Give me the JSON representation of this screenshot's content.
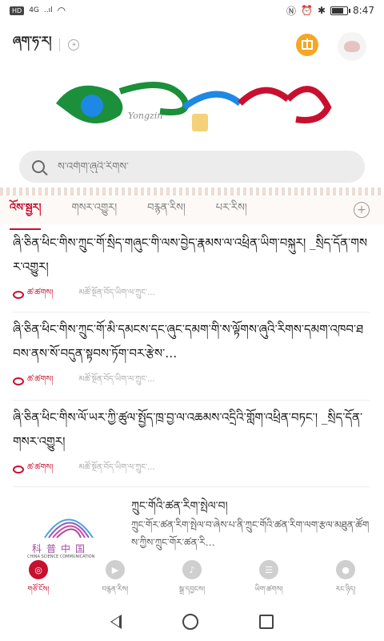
{
  "status_bar": {
    "left_badge": "HD",
    "network": "4G",
    "signal": "..ıl",
    "time": "8:47",
    "battery_level": 0.8
  },
  "header": {
    "city": "ཞག་ཧ་ར།",
    "weather_icon": "weather-icon",
    "gift_icon": "gift-icon",
    "avatar_icon": "avatar-icon"
  },
  "logo": {
    "text": "Yongzin",
    "colors": [
      "#1b8f3a",
      "#1e88e5",
      "#c8102e",
      "#d4a21a"
    ]
  },
  "search": {
    "placeholder": "ས་འགོག་ཞུའི་རིགས་"
  },
  "tabs": [
    {
      "label": "འོས་སྦྱར།",
      "active": true
    },
    {
      "label": "གསར་འགྱུར།",
      "active": false
    },
    {
      "label": "བརྙན་རིས།",
      "active": false
    },
    {
      "label": "པར་རིས།",
      "active": false
    }
  ],
  "articles": [
    {
      "title": "ཞི་ཅིན་ཕིང་གིས་ཀྲུང་གོ་སྲིད་གཞུང་གི་ལས་བྱེད་རྣམས་ལ་འཕྲིན་ཡིག་བསྐུར། _སྲིད་དོན་གསར་འགྱུར།",
      "source": "ཚ་ཚགས།",
      "meta": "མཚོ་སྔོན་བོད་ཡིག་ལ་ཀྲུང་..."
    },
    {
      "title": "ཞི་ཅིན་ཕིང་གིས་ཀྲུང་གོ་མི་དམངས་དང་ཞུང་དམག་གི་ས་ལྟོགས་ཞུའི་རིགས་དམག་འཁབ་ཐབས་ནས་སོ་བདུན་སྟབས་ཏོག་བར་རྩེས་…",
      "source": "ཚ་ཚགས།",
      "meta": "མཚོ་སྔོན་བོད་ཡིག་ལ་ཀྲུང་..."
    },
    {
      "title": "ཞི་ཅིན་ཕིང་གིས་ལོ་ཡར་ཀྱི་ཚུལ་སྤྱོད་ཁྲ་བྱ་ལ་འཆམས་འདྲིའི་གློག་འཕྲིན་བཏང་། _སྲིད་དོན་གསར་འགྱུར།",
      "source": "ཚ་ཚགས།",
      "meta": "མཚོ་སྔོན་བོད་ཡིག་ལ་ཀྲུང་..."
    }
  ],
  "article_image": {
    "title": "ཀྲུང་གོའི་ཚན་རིག་སྤེལ་བ།",
    "summary": "ཀྲུང་གོར་ཚན་རིག་སྤེལ་བ་ཞེས་པ་ནི་ཀྲུང་གོའི་ཚན་རིག་ལག་རྩལ་མཐུན་ཚོགས་ཀྱིས་ཀྲུང་གོར་ཚན་རི…",
    "image_cn": "科普中国",
    "image_en": "CHINA SCIENCE COMMUNICATION"
  },
  "bottom_nav": [
    {
      "label": "གཙོ་ངོས།",
      "icon": "home-icon",
      "active": true
    },
    {
      "label": "བརྙན་རིས།",
      "icon": "play-icon",
      "active": false
    },
    {
      "label": "སྒྲ་དབྱངས།",
      "icon": "music-icon",
      "active": false
    },
    {
      "label": "ཡིག་ཚགས།",
      "icon": "book-icon",
      "active": false
    },
    {
      "label": "རང་ཉིད།",
      "icon": "user-icon",
      "active": false
    }
  ]
}
